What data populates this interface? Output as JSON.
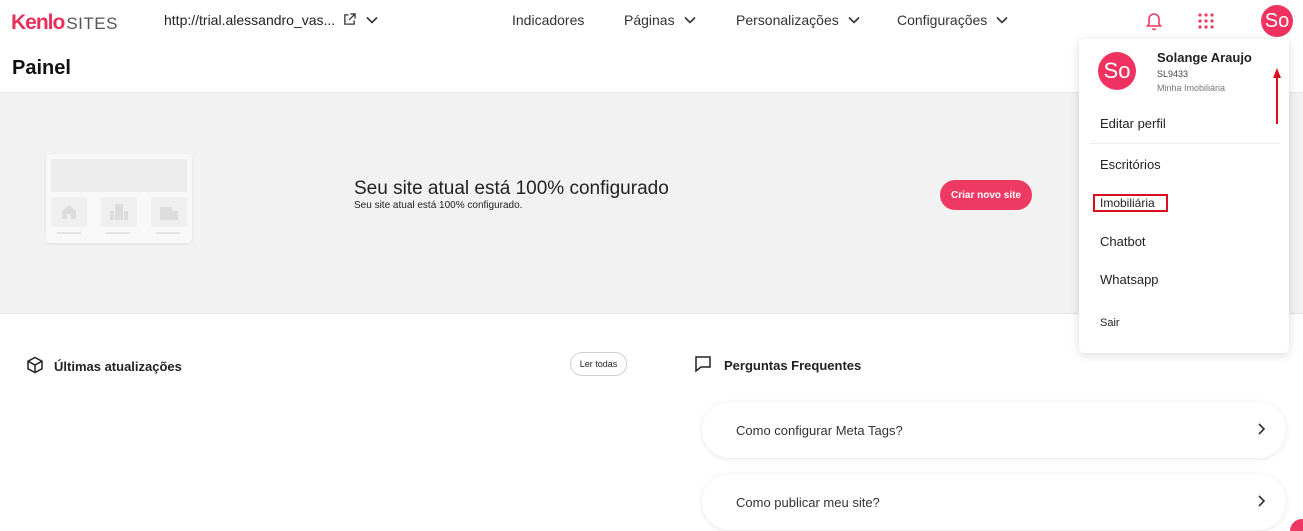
{
  "topbar": {
    "logo_brand": "Kenlo",
    "logo_product": "SITES",
    "url": "http://trial.alessandro_vas...",
    "nav": {
      "indicadores": "Indicadores",
      "paginas": "Páginas",
      "personalizacoes": "Personalizações",
      "configuracoes": "Configurações"
    },
    "avatar_initials": "So"
  },
  "page_title": "Painel",
  "hero": {
    "title": "Seu site atual está 100% configurado",
    "subtitle": "Seu site atual está 100% configurado.",
    "button_label": "Criar novo site"
  },
  "updates": {
    "title": "Últimas atualizações",
    "read_all": "Ler todas"
  },
  "faq": {
    "title": "Perguntas Frequentes",
    "items": [
      {
        "label": "Como configurar Meta Tags?"
      },
      {
        "label": "Como publicar meu site?"
      }
    ]
  },
  "user_menu": {
    "avatar_initials": "So",
    "name": "Solange Araujo",
    "code": "SL9433",
    "agency": "Minha Imobiliária",
    "items": [
      {
        "label": "Editar perfil"
      },
      {
        "label": "Escritórios"
      },
      {
        "label": "Imobiliária"
      },
      {
        "label": "Chatbot"
      },
      {
        "label": "Whatsapp"
      },
      {
        "label": "Sair"
      }
    ]
  },
  "colors": {
    "accent": "#ee3a62",
    "highlight_box": "#d90f1f",
    "hero_bg": "#f2f2f2"
  }
}
